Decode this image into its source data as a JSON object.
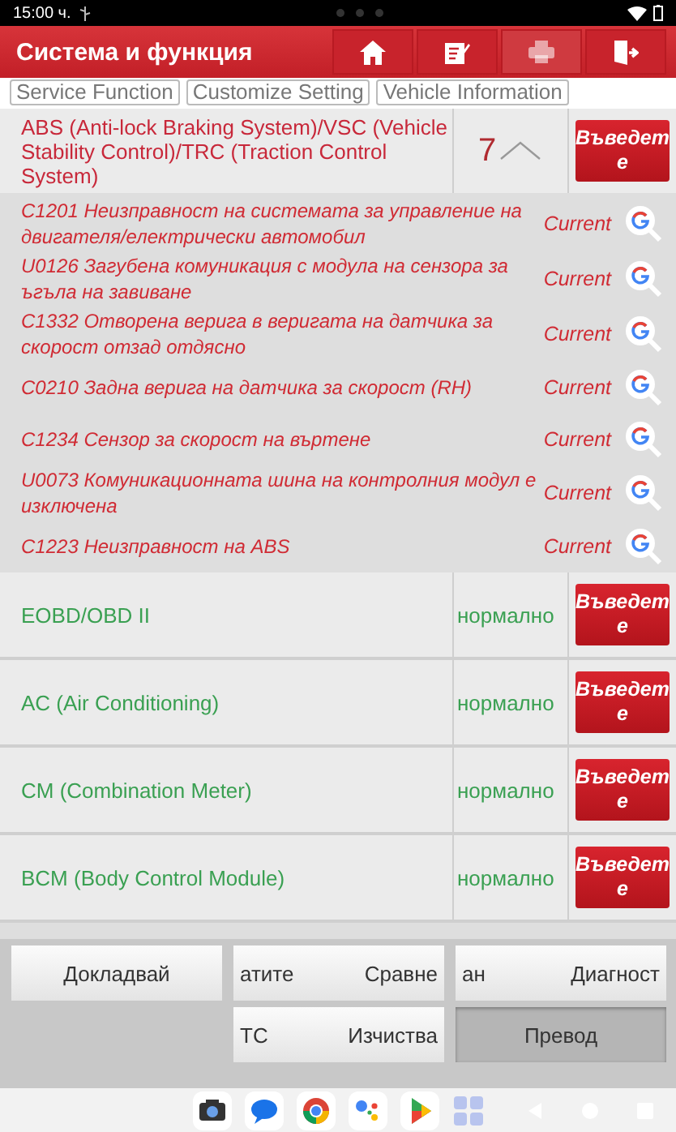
{
  "status_bar": {
    "time": "15:00 ч."
  },
  "header": {
    "title": "Система и функция",
    "tools": [
      {
        "kind": "home",
        "disabled": false
      },
      {
        "kind": "edit",
        "disabled": false
      },
      {
        "kind": "print",
        "disabled": true
      },
      {
        "kind": "exit",
        "disabled": false
      }
    ]
  },
  "tabs": [
    "Service Function",
    "Customize Setting",
    "Vehicle Information"
  ],
  "systems": [
    {
      "name": "ABS (Anti-lock Braking System)/VSC (Vehicle Stability Control)/TRC (Traction Control System)",
      "kind": "fault",
      "status": "7",
      "expanded": true,
      "button": "Въведете",
      "faults": [
        {
          "text": "C1201 Неизправност на системата за управление на двигателя/електрически автомобил",
          "state": "Current"
        },
        {
          "text": "U0126 Загубена комуникация с модула на сензора за ъгъла на завиване",
          "state": "Current"
        },
        {
          "text": "C1332 Отворена верига в веригата на датчика за скорост отзад отдясно",
          "state": "Current"
        },
        {
          "text": "C0210 Задна верига на датчика за скорост (RH)",
          "state": "Current"
        },
        {
          "text": "C1234 Сензор за скорост на въртене",
          "state": "Current"
        },
        {
          "text": "U0073 Комуникационната шина на контролния модул е изключена",
          "state": "Current"
        },
        {
          "text": "C1223 Неизправност на ABS",
          "state": "Current"
        }
      ]
    },
    {
      "name": "EOBD/OBD II",
      "kind": "normal",
      "status": "нормално",
      "expanded": false,
      "button": "Въведете"
    },
    {
      "name": "AC (Air Conditioning)",
      "kind": "normal",
      "status": "нормално",
      "expanded": false,
      "button": "Въведете"
    },
    {
      "name": "CM (Combination Meter)",
      "kind": "normal",
      "status": "нормално",
      "expanded": false,
      "button": "Въведете"
    },
    {
      "name": "BCM (Body Control Module)",
      "kind": "normal",
      "status": "нормално",
      "expanded": false,
      "button": "Въведете"
    }
  ],
  "actions": [
    {
      "parts": [
        "Докладвай"
      ],
      "disabled": false
    },
    {
      "parts": [
        "атите",
        "Сравне"
      ],
      "disabled": false
    },
    {
      "parts": [
        "ан",
        "Диагност"
      ],
      "disabled": false
    },
    {
      "parts": [
        "TC",
        "Изчиства"
      ],
      "disabled": false
    },
    {
      "parts": [
        "Превод"
      ],
      "disabled": true
    }
  ]
}
